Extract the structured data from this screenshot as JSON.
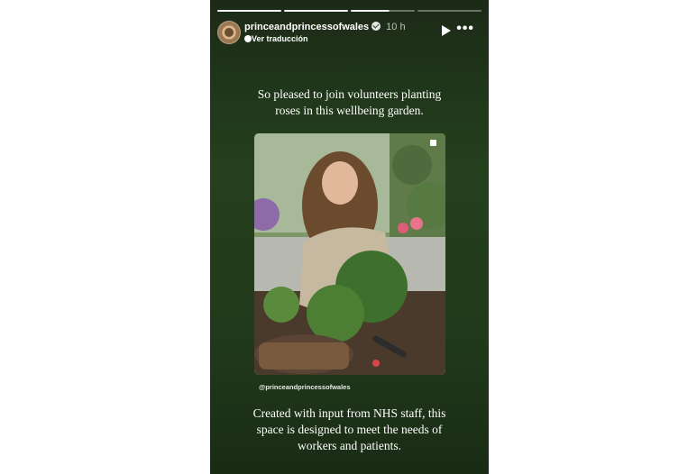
{
  "progress_segments": [
    {
      "state": "done"
    },
    {
      "state": "done"
    },
    {
      "state": "active"
    },
    {
      "state": "pending"
    }
  ],
  "header": {
    "username": "princeandprincessofwales",
    "time": "10 h",
    "translate_label": "Ver traducción",
    "icons": [
      "avatar",
      "verified-badge-icon",
      "globe-icon",
      "play-icon",
      "more-icon"
    ]
  },
  "caption_top": "So pleased to join volunteers planting roses in this wellbeing garden.",
  "photo": {
    "tag": "@princeandprincessofwales"
  },
  "caption_bottom": "Created with input from NHS staff, this space is designed to meet the needs of workers and patients.",
  "colors": {
    "background_top": "#1c2a17",
    "background_mid": "#24401d",
    "text": "#ffffff"
  }
}
